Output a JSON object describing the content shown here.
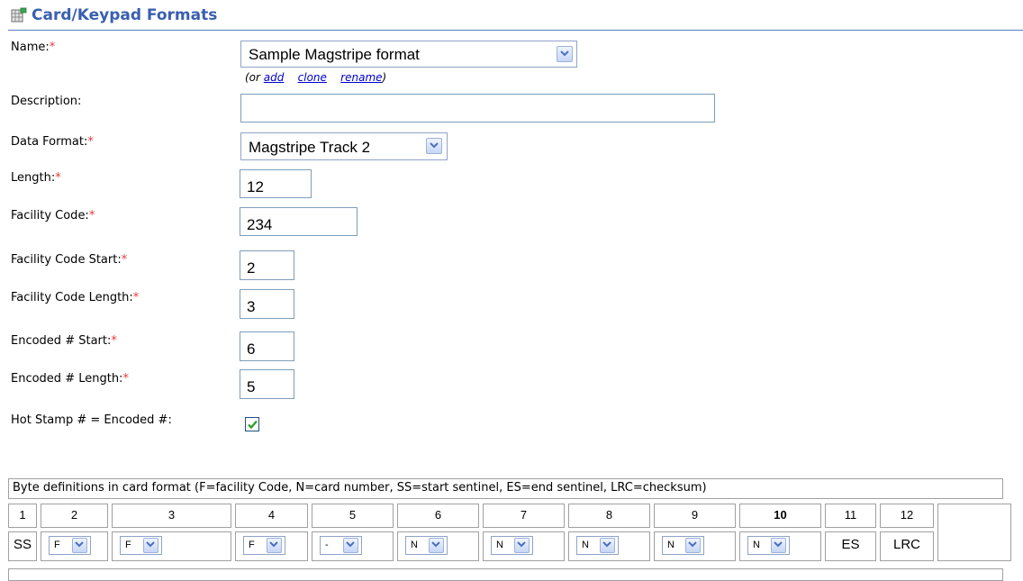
{
  "header": {
    "title": "Card/Keypad Formats",
    "icon": "table-icon"
  },
  "form": {
    "name": {
      "label": "Name:",
      "required": "*",
      "value": "Sample Magstripe format"
    },
    "links": {
      "prefix": "(or ",
      "add": "add",
      "clone": "clone",
      "rename": "rename",
      "suffix": ")"
    },
    "description": {
      "label": "Description:",
      "value": ""
    },
    "data_format": {
      "label": "Data Format:",
      "required": "*",
      "value": "Magstripe Track 2"
    },
    "length": {
      "label": "Length:",
      "required": "*",
      "value": "12"
    },
    "facility_code": {
      "label": "Facility Code:",
      "required": "*",
      "value": "234"
    },
    "facility_code_start": {
      "label": "Facility Code Start:",
      "required": "*",
      "value": "2"
    },
    "facility_code_length": {
      "label": "Facility Code Length:",
      "required": "*",
      "value": "3"
    },
    "encoded_start": {
      "label": "Encoded # Start:",
      "required": "*",
      "value": "6"
    },
    "encoded_length": {
      "label": "Encoded # Length:",
      "required": "*",
      "value": "5"
    },
    "hot_stamp": {
      "label": "Hot Stamp # = Encoded #:",
      "checked": true
    }
  },
  "byte_table": {
    "caption": "Byte definitions in card format (F=facility Code, N=card number, SS=start sentinel, ES=end sentinel, LRC=checksum)",
    "columns": [
      "1",
      "2",
      "3",
      "4",
      "5",
      "6",
      "7",
      "8",
      "9",
      "10",
      "11",
      "12"
    ],
    "values": [
      "SS",
      "F",
      "F",
      "F",
      "-",
      "N",
      "N",
      "N",
      "N",
      "N",
      "ES",
      "LRC"
    ]
  },
  "colors": {
    "title": "#3a5fb0",
    "required": "#e23b3b",
    "link": "#0000cc",
    "check": "#2fa12f"
  }
}
